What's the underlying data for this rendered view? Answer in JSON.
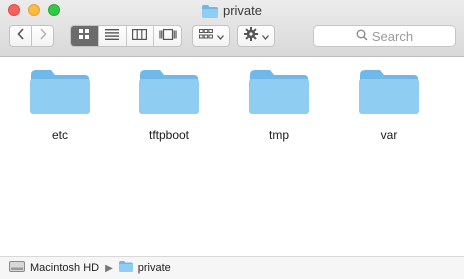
{
  "window": {
    "title": "private"
  },
  "toolbar": {
    "search_placeholder": "Search"
  },
  "folders": [
    {
      "name": "etc"
    },
    {
      "name": "tftpboot"
    },
    {
      "name": "tmp"
    },
    {
      "name": "var"
    }
  ],
  "pathbar": {
    "items": [
      {
        "label": "Macintosh HD",
        "icon": "hard-drive-icon"
      },
      {
        "label": "private",
        "icon": "folder-icon"
      }
    ]
  },
  "colors": {
    "folder_body": "#8fcdf3",
    "folder_tab": "#6fb8ea",
    "active_segment": "#6b6b6b"
  }
}
